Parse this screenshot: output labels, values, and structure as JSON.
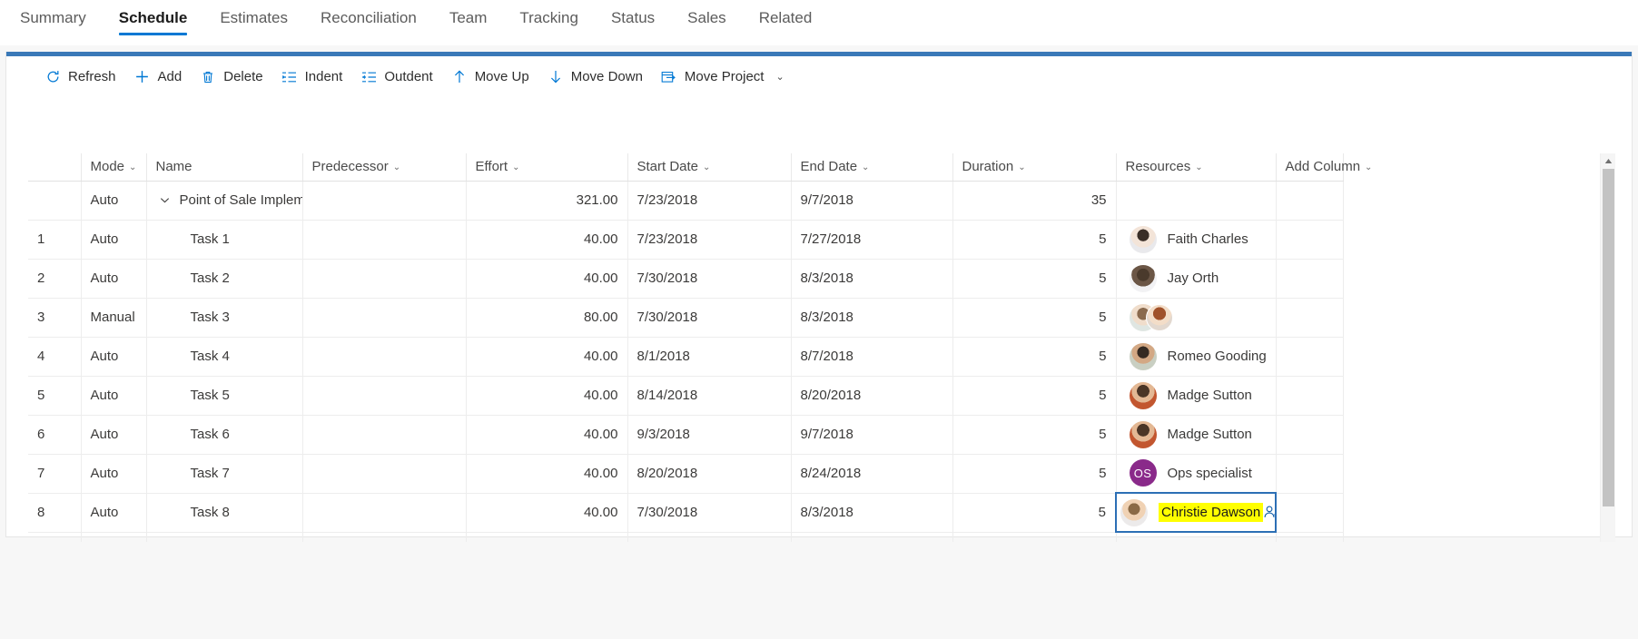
{
  "tabs": [
    {
      "label": "Summary",
      "active": false
    },
    {
      "label": "Schedule",
      "active": true
    },
    {
      "label": "Estimates",
      "active": false
    },
    {
      "label": "Reconciliation",
      "active": false
    },
    {
      "label": "Team",
      "active": false
    },
    {
      "label": "Tracking",
      "active": false
    },
    {
      "label": "Status",
      "active": false
    },
    {
      "label": "Sales",
      "active": false
    },
    {
      "label": "Related",
      "active": false
    }
  ],
  "commandbar": {
    "items": [
      {
        "label": "Refresh",
        "icon": "refresh-icon",
        "caret": ""
      },
      {
        "label": "Add",
        "icon": "add-icon",
        "caret": ""
      },
      {
        "label": "Delete",
        "icon": "trash-icon",
        "caret": ""
      },
      {
        "label": "Indent",
        "icon": "indent-icon",
        "caret": ""
      },
      {
        "label": "Outdent",
        "icon": "outdent-icon",
        "caret": ""
      },
      {
        "label": "Move Up",
        "icon": "arrow-up-icon",
        "caret": ""
      },
      {
        "label": "Move Down",
        "icon": "arrow-down-icon",
        "caret": ""
      },
      {
        "label": "Move Project",
        "icon": "move-project-icon",
        "caret": "⌄"
      }
    ]
  },
  "grid": {
    "columns": [
      {
        "label": "",
        "sortable": false
      },
      {
        "label": "Mode",
        "sortable": true
      },
      {
        "label": "Name",
        "sortable": false
      },
      {
        "label": "Predecessor",
        "sortable": true
      },
      {
        "label": "Effort",
        "sortable": true
      },
      {
        "label": "Start Date",
        "sortable": true
      },
      {
        "label": "End Date",
        "sortable": true
      },
      {
        "label": "Duration",
        "sortable": true
      },
      {
        "label": "Resources",
        "sortable": true
      },
      {
        "label": "Add Column",
        "sortable": true
      }
    ],
    "caret_glyph": "⌄",
    "summary_row": {
      "num": "",
      "mode": "Auto",
      "name": "Point of Sale Implementat",
      "predecessor": "",
      "effort": "321.00",
      "start": "7/23/2018",
      "end": "9/7/2018",
      "duration": "35",
      "resources": [],
      "expander": "chevron-down-icon"
    },
    "rows": [
      {
        "num": "1",
        "mode": "Auto",
        "name": "Task 1",
        "predecessor": "",
        "effort": "40.00",
        "start": "7/23/2018",
        "end": "7/27/2018",
        "duration": "5",
        "resources": [
          {
            "name": "Faith Charles",
            "type": "photo",
            "tone": "#e3cdbe"
          }
        ]
      },
      {
        "num": "2",
        "mode": "Auto",
        "name": "Task 2",
        "predecessor": "",
        "effort": "40.00",
        "start": "7/30/2018",
        "end": "8/3/2018",
        "duration": "5",
        "resources": [
          {
            "name": "Jay Orth",
            "type": "photo",
            "tone": "#6b5646"
          }
        ]
      },
      {
        "num": "3",
        "mode": "Manual",
        "name": "Task 3",
        "predecessor": "",
        "effort": "80.00",
        "start": "7/30/2018",
        "end": "8/3/2018",
        "duration": "5",
        "resources": [
          {
            "name": "",
            "type": "photo",
            "tone": "#cfd8d2"
          },
          {
            "name": "",
            "type": "photo",
            "tone": "#d8b49b"
          }
        ]
      },
      {
        "num": "4",
        "mode": "Auto",
        "name": "Task 4",
        "predecessor": "",
        "effort": "40.00",
        "start": "8/1/2018",
        "end": "8/7/2018",
        "duration": "5",
        "resources": [
          {
            "name": "Romeo Gooding",
            "type": "photo",
            "tone": "#7d6a58"
          }
        ]
      },
      {
        "num": "5",
        "mode": "Auto",
        "name": "Task 5",
        "predecessor": "",
        "effort": "40.00",
        "start": "8/14/2018",
        "end": "8/20/2018",
        "duration": "5",
        "resources": [
          {
            "name": "Madge Sutton",
            "type": "photo",
            "tone": "#c0643f"
          }
        ]
      },
      {
        "num": "6",
        "mode": "Auto",
        "name": "Task 6",
        "predecessor": "",
        "effort": "40.00",
        "start": "9/3/2018",
        "end": "9/7/2018",
        "duration": "5",
        "resources": [
          {
            "name": "Madge Sutton",
            "type": "photo",
            "tone": "#c0643f"
          }
        ]
      },
      {
        "num": "7",
        "mode": "Auto",
        "name": "Task 7",
        "predecessor": "",
        "effort": "40.00",
        "start": "8/20/2018",
        "end": "8/24/2018",
        "duration": "5",
        "resources": [
          {
            "name": "Ops specialist",
            "type": "initials",
            "initials": "OS",
            "color": "#8a2a8a"
          }
        ]
      },
      {
        "num": "8",
        "mode": "Auto",
        "name": "Task 8",
        "predecessor": "",
        "effort": "40.00",
        "start": "7/30/2018",
        "end": "8/3/2018",
        "duration": "5",
        "resources": [
          {
            "name": "Christie Dawson",
            "type": "photo",
            "tone": "#d8b08a"
          }
        ],
        "selected": true,
        "highlight_color": "#ffff00",
        "add_icon": "add-person-icon"
      }
    ]
  },
  "scrollbar": {
    "up_arrow": "triangle-up-icon",
    "thumb": "scroll-thumb"
  },
  "colors": {
    "accent": "#0078d4",
    "panel_top_bar": "#3a79b8",
    "selection_border": "#2c6fb5",
    "highlight": "#ffff00",
    "initials_bg": "#8a2a8a"
  }
}
